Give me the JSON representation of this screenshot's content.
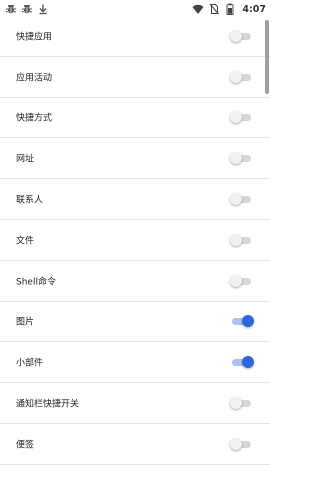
{
  "status_bar": {
    "time": "4:07",
    "left_icons": [
      "bug-icon",
      "bug-icon",
      "download-icon"
    ],
    "right_icons": [
      "wifi-icon",
      "no-sim-icon",
      "battery-icon"
    ]
  },
  "settings": {
    "items": [
      {
        "label": "快捷应用",
        "enabled": false
      },
      {
        "label": "应用活动",
        "enabled": false
      },
      {
        "label": "快捷方式",
        "enabled": false
      },
      {
        "label": "网址",
        "enabled": false
      },
      {
        "label": "联系人",
        "enabled": false
      },
      {
        "label": "文件",
        "enabled": false
      },
      {
        "label": "Shell命令",
        "enabled": false
      },
      {
        "label": "图片",
        "enabled": true
      },
      {
        "label": "小部件",
        "enabled": true
      },
      {
        "label": "通知栏快捷开关",
        "enabled": false
      },
      {
        "label": "便签",
        "enabled": false
      }
    ]
  },
  "colors": {
    "accent": "#2e67dc",
    "accent_track": "#a9c2ee",
    "off_track": "#d6d6d6",
    "divider": "#e4e4e4"
  }
}
